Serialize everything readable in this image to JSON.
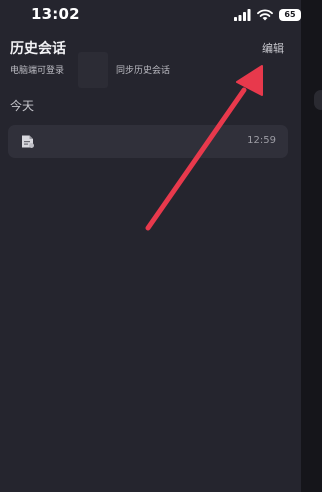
{
  "status_bar": {
    "time": "13:02",
    "battery": "65",
    "icons": [
      "signal-icon",
      "wifi-icon",
      "battery-icon"
    ]
  },
  "header": {
    "title": "历史会话",
    "edit_label": "编辑",
    "login_label": "电脑端可登录",
    "sync_label": "同步历史会话"
  },
  "sections": [
    {
      "label": "今天",
      "items": [
        {
          "icon": "document-icon",
          "time": "12:59"
        }
      ]
    }
  ],
  "colors": {
    "background": "#25252e",
    "item_background": "#30303a",
    "annotation_arrow": "#e8394c",
    "text_primary": "#f2f2f5"
  }
}
